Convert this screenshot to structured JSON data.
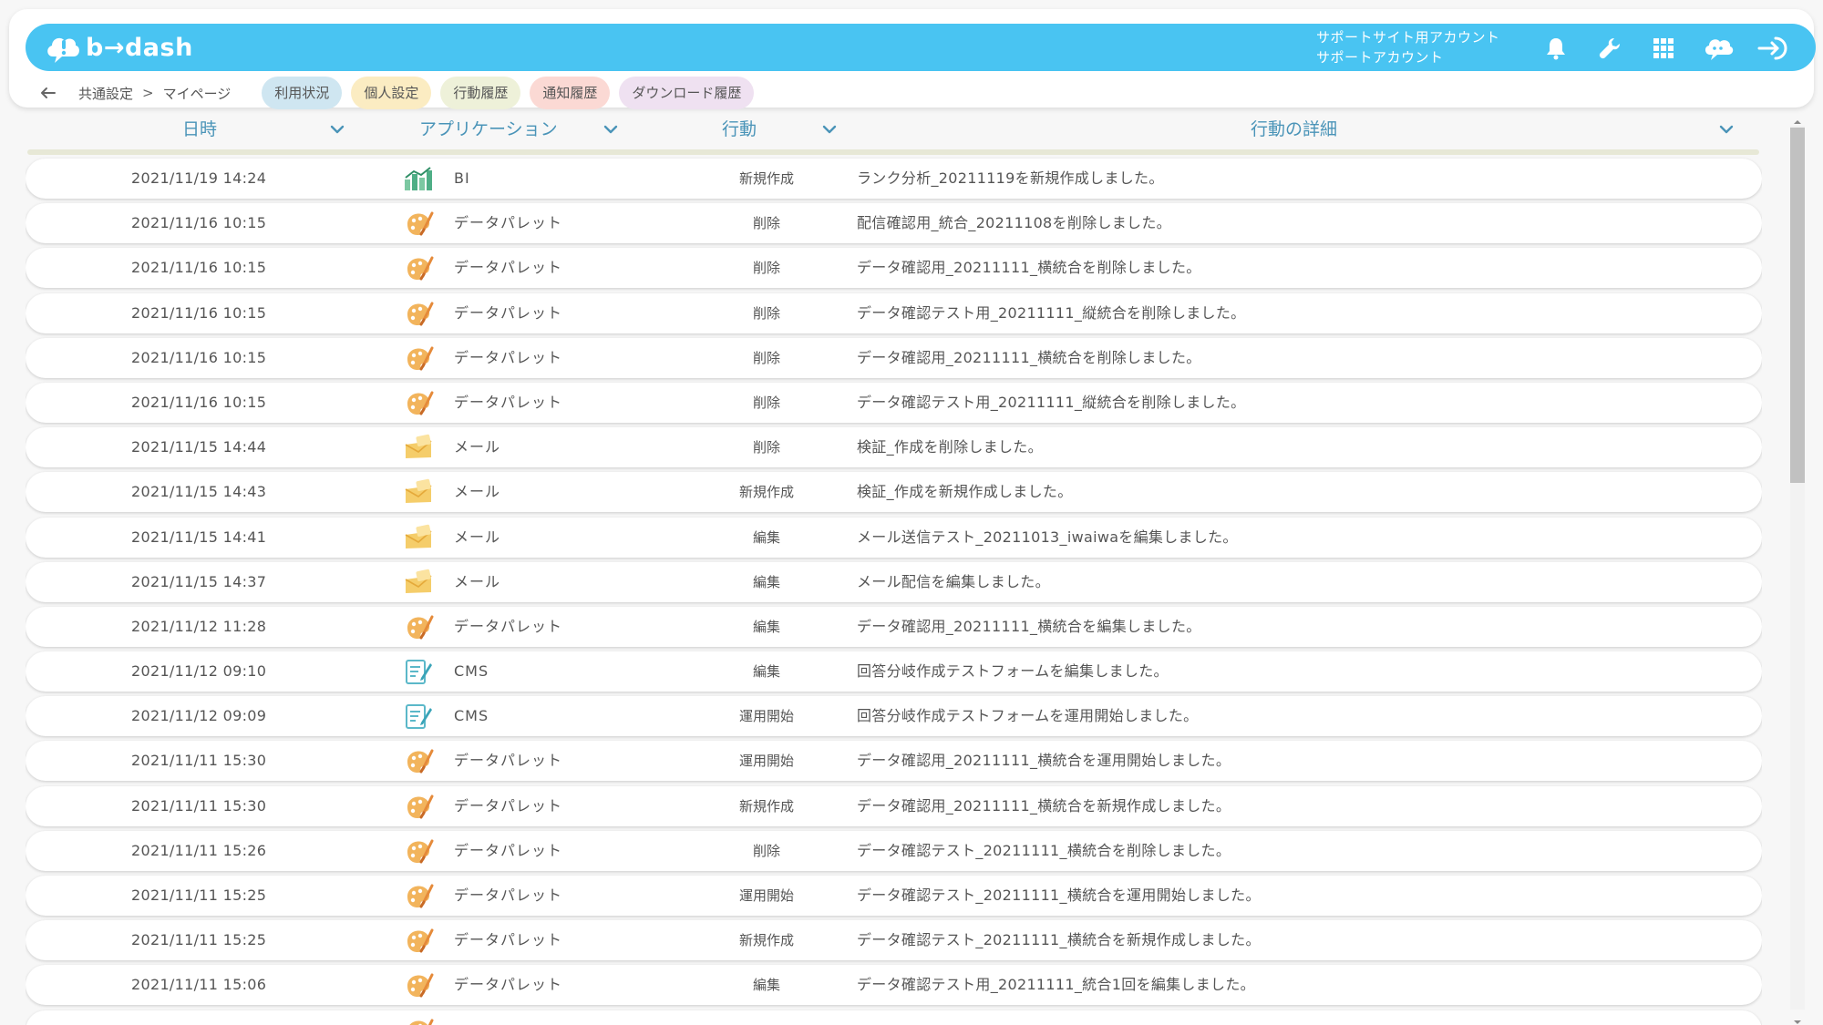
{
  "app": {
    "logo_text": "b→dash",
    "account_line1": "サポートサイト用アカウント",
    "account_line2": "サポートアカウント"
  },
  "icons": {
    "notification": "bell-icon",
    "tools": "wrench-icon",
    "apps": "grid-icon",
    "assistant": "chat-cloud-icon",
    "logout": "logout-icon",
    "back": "back-arrow-icon"
  },
  "breadcrumb": {
    "first": "共通設定",
    "separator": ">",
    "second": "マイページ"
  },
  "tabs": [
    {
      "label": "利用状況",
      "color": "#cfe6f1"
    },
    {
      "label": "個人設定",
      "color": "#fbecc2"
    },
    {
      "label": "行動履歴",
      "color": "#eef1d9"
    },
    {
      "label": "通知履歴",
      "color": "#fbd9d4"
    },
    {
      "label": "ダウンロード履歴",
      "color": "#efe1f1"
    }
  ],
  "table": {
    "headers": {
      "date": "日時",
      "app": "アプリケーション",
      "action": "行動",
      "detail": "行動の詳細"
    },
    "rows": [
      {
        "date": "2021/11/19 14:24",
        "app_icon": "bi",
        "app": "BI",
        "action": "新規作成",
        "detail": "ランク分析_20211119を新規作成しました。"
      },
      {
        "date": "2021/11/16 10:15",
        "app_icon": "palette",
        "app": "データパレット",
        "action": "削除",
        "detail": "配信確認用_統合_20211108を削除しました。"
      },
      {
        "date": "2021/11/16 10:15",
        "app_icon": "palette",
        "app": "データパレット",
        "action": "削除",
        "detail": "データ確認用_20211111_横統合を削除しました。"
      },
      {
        "date": "2021/11/16 10:15",
        "app_icon": "palette",
        "app": "データパレット",
        "action": "削除",
        "detail": "データ確認テスト用_20211111_縦統合を削除しました。"
      },
      {
        "date": "2021/11/16 10:15",
        "app_icon": "palette",
        "app": "データパレット",
        "action": "削除",
        "detail": "データ確認用_20211111_横統合を削除しました。"
      },
      {
        "date": "2021/11/16 10:15",
        "app_icon": "palette",
        "app": "データパレット",
        "action": "削除",
        "detail": "データ確認テスト用_20211111_縦統合を削除しました。"
      },
      {
        "date": "2021/11/15 14:44",
        "app_icon": "mail",
        "app": "メール",
        "action": "削除",
        "detail": "検証_作成を削除しました。"
      },
      {
        "date": "2021/11/15 14:43",
        "app_icon": "mail",
        "app": "メール",
        "action": "新規作成",
        "detail": "検証_作成を新規作成しました。"
      },
      {
        "date": "2021/11/15 14:41",
        "app_icon": "mail",
        "app": "メール",
        "action": "編集",
        "detail": "メール送信テスト_20211013_iwaiwaを編集しました。"
      },
      {
        "date": "2021/11/15 14:37",
        "app_icon": "mail",
        "app": "メール",
        "action": "編集",
        "detail": "メール配信を編集しました。"
      },
      {
        "date": "2021/11/12 11:28",
        "app_icon": "palette",
        "app": "データパレット",
        "action": "編集",
        "detail": "データ確認用_20211111_横統合を編集しました。"
      },
      {
        "date": "2021/11/12 09:10",
        "app_icon": "cms",
        "app": "CMS",
        "action": "編集",
        "detail": "回答分岐作成テストフォームを編集しました。"
      },
      {
        "date": "2021/11/12 09:09",
        "app_icon": "cms",
        "app": "CMS",
        "action": "運用開始",
        "detail": "回答分岐作成テストフォームを運用開始しました。"
      },
      {
        "date": "2021/11/11 15:30",
        "app_icon": "palette",
        "app": "データパレット",
        "action": "運用開始",
        "detail": "データ確認用_20211111_横統合を運用開始しました。"
      },
      {
        "date": "2021/11/11 15:30",
        "app_icon": "palette",
        "app": "データパレット",
        "action": "新規作成",
        "detail": "データ確認用_20211111_横統合を新規作成しました。"
      },
      {
        "date": "2021/11/11 15:26",
        "app_icon": "palette",
        "app": "データパレット",
        "action": "削除",
        "detail": "データ確認テスト_20211111_横統合を削除しました。"
      },
      {
        "date": "2021/11/11 15:25",
        "app_icon": "palette",
        "app": "データパレット",
        "action": "運用開始",
        "detail": "データ確認テスト_20211111_横統合を運用開始しました。"
      },
      {
        "date": "2021/11/11 15:25",
        "app_icon": "palette",
        "app": "データパレット",
        "action": "新規作成",
        "detail": "データ確認テスト_20211111_横統合を新規作成しました。"
      },
      {
        "date": "2021/11/11 15:06",
        "app_icon": "palette",
        "app": "データパレット",
        "action": "編集",
        "detail": "データ確認テスト用_20211111_統合1回を編集しました。"
      },
      {
        "date": "",
        "app_icon": "palette",
        "app": "",
        "action": "",
        "detail": ""
      }
    ]
  },
  "colors": {
    "topbar": "#49c4f2",
    "header_text": "#4a94b8",
    "header_line": "#e7e8d6"
  }
}
